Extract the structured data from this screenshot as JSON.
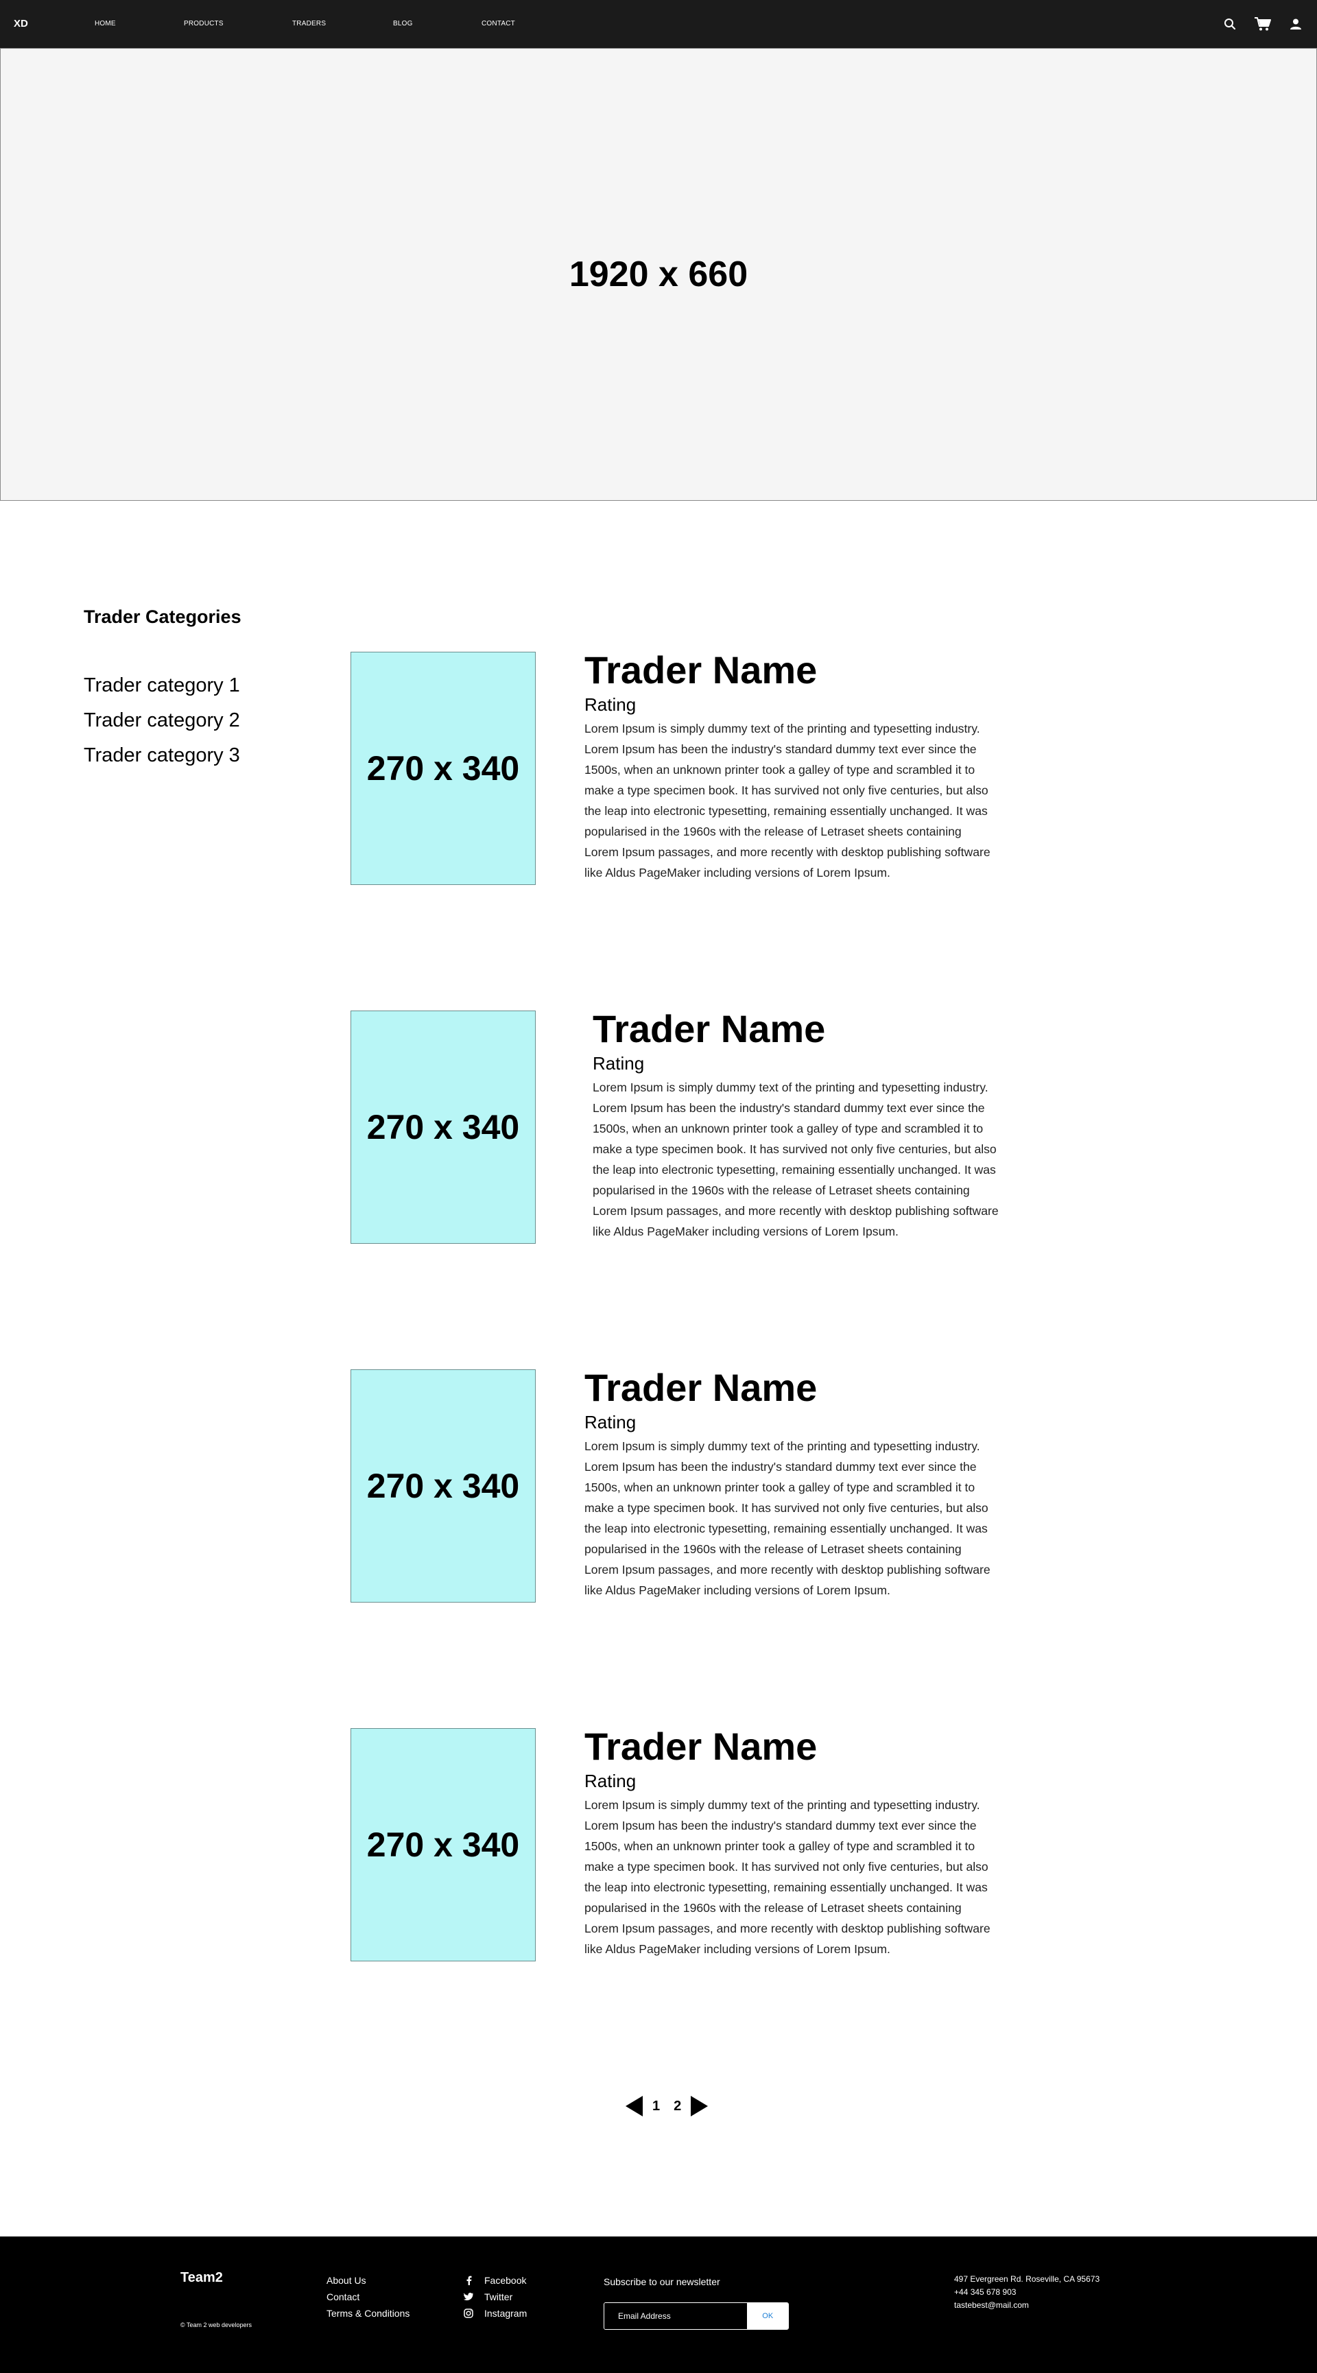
{
  "nav": {
    "logo": "XD",
    "links": [
      "HOME",
      "PRODUCTS",
      "TRADERS",
      "BLOG",
      "CONTACT"
    ],
    "icons": [
      "search-icon",
      "cart-icon",
      "user-icon"
    ]
  },
  "hero": {
    "label": "1920 x 660"
  },
  "sidebar": {
    "title": "Trader Categories",
    "categories": [
      "Trader category 1",
      "Trader category 2",
      "Trader category 3"
    ]
  },
  "traders": [
    {
      "image_label": "270 x 340",
      "name": "Trader Name",
      "rating": "Rating",
      "description": "Lorem Ipsum is simply dummy text of the printing and typesetting industry. Lorem Ipsum has been the industry's standard dummy text ever since the 1500s, when an unknown printer took a galley of type and scrambled it to make a type specimen book. It has survived not only five centuries, but also the leap into electronic typesetting, remaining essentially unchanged. It was popularised in the 1960s with the release of Letraset sheets containing Lorem Ipsum passages, and more recently with desktop publishing software like Aldus PageMaker including versions of Lorem Ipsum."
    },
    {
      "image_label": "270 x 340",
      "name": "Trader Name",
      "rating": "Rating",
      "description": "Lorem Ipsum is simply dummy text of the printing and typesetting industry. Lorem Ipsum has been the industry's standard dummy text ever since the 1500s, when an unknown printer took a galley of type and scrambled it to make a type specimen book. It has survived not only five centuries, but also the leap into electronic typesetting, remaining essentially unchanged. It was popularised in the 1960s with the release of Letraset sheets containing Lorem Ipsum passages, and more recently with desktop publishing software like Aldus PageMaker including versions of Lorem Ipsum."
    },
    {
      "image_label": "270 x 340",
      "name": "Trader Name",
      "rating": "Rating",
      "description": "Lorem Ipsum is simply dummy text of the printing and typesetting industry. Lorem Ipsum has been the industry's standard dummy text ever since the 1500s, when an unknown printer took a galley of type and scrambled it to make a type specimen book. It has survived not only five centuries, but also the leap into electronic typesetting, remaining essentially unchanged. It was popularised in the 1960s with the release of Letraset sheets containing Lorem Ipsum passages, and more recently with desktop publishing software like Aldus PageMaker including versions of Lorem Ipsum."
    },
    {
      "image_label": "270 x 340",
      "name": "Trader Name",
      "rating": "Rating",
      "description": "Lorem Ipsum is simply dummy text of the printing and typesetting industry. Lorem Ipsum has been the industry's standard dummy text ever since the 1500s, when an unknown printer took a galley of type and scrambled it to make a type specimen book. It has survived not only five centuries, but also the leap into electronic typesetting, remaining essentially unchanged. It was popularised in the 1960s with the release of Letraset sheets containing Lorem Ipsum passages, and more recently with desktop publishing software like Aldus PageMaker including versions of Lorem Ipsum."
    }
  ],
  "pagination": {
    "pages": [
      "1",
      "2"
    ],
    "current": "1"
  },
  "footer": {
    "brand": "Team2",
    "copyright": "© Team 2 web developers",
    "links": [
      "About Us",
      "Contact",
      "Terms & Conditions"
    ],
    "social": [
      {
        "label": "Facebook",
        "icon": "facebook-icon"
      },
      {
        "label": "Twitter",
        "icon": "twitter-icon"
      },
      {
        "label": "Instagram",
        "icon": "instagram-icon"
      }
    ],
    "newsletter": {
      "title": "Subscribe to our newsletter",
      "placeholder": "Email Address",
      "button": "OK"
    },
    "contact": [
      "497 Evergreen Rd. Roseville, CA 95673",
      "+44 345 678 903",
      "tastebest@mail.com"
    ]
  },
  "colors": {
    "nav_bg": "#1b1b1b",
    "hero_bg": "#f5f5f5",
    "image_placeholder": "#b8f6f6",
    "footer_bg": "#000000",
    "newsletter_button_text": "#1e7fd6"
  }
}
